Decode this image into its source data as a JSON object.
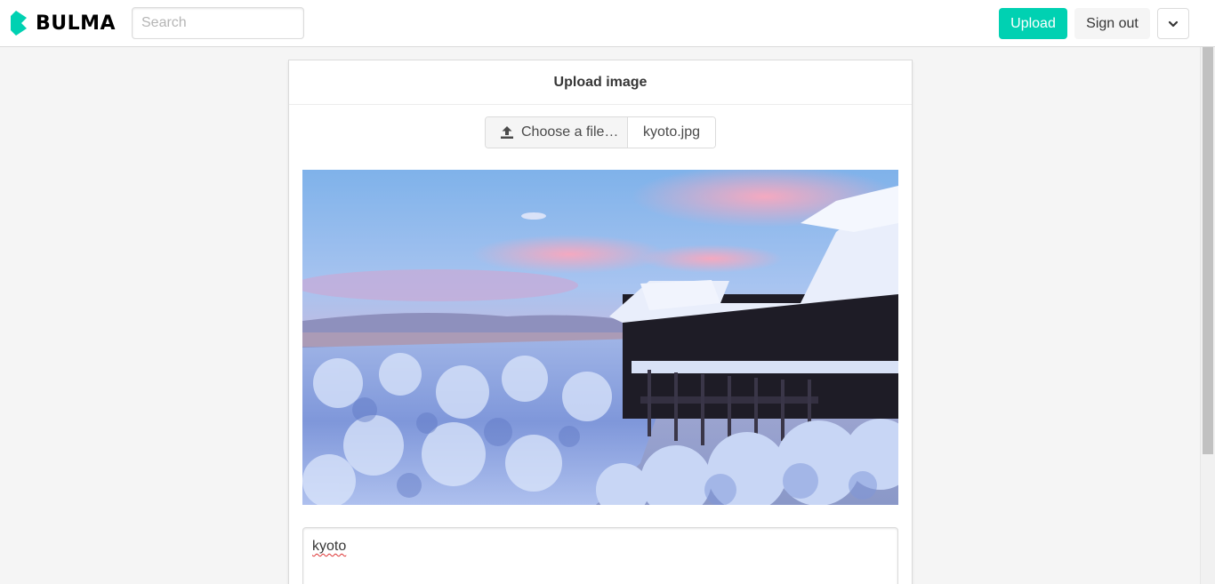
{
  "brand": {
    "name": "BULMA",
    "accent": "#00d1b2"
  },
  "navbar": {
    "search_placeholder": "Search",
    "upload_label": "Upload",
    "signout_label": "Sign out",
    "menu_icon": "chevron-down-icon"
  },
  "card": {
    "title": "Upload image",
    "file": {
      "button_label": "Choose a file…",
      "file_name": "kyoto.jpg",
      "icon": "upload-icon"
    },
    "image": {
      "subject": "snowy temple at dusk"
    },
    "caption_value": "kyoto"
  }
}
